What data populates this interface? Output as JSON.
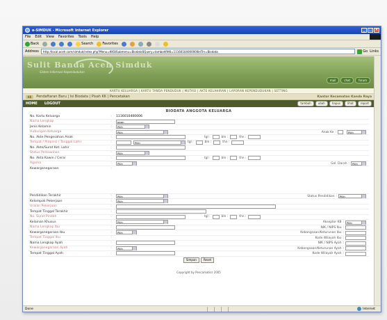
{
  "window": {
    "title": "e-SIMDUK - Microsoft Internet Explorer",
    "controls": [
      "_",
      "□",
      "×"
    ]
  },
  "menu": [
    "File",
    "Edit",
    "View",
    "Favorites",
    "Tools",
    "Help"
  ],
  "toolbar": {
    "back": "Back",
    "search": "Search",
    "favorites": "Favorites"
  },
  "address": {
    "label": "Address",
    "url": "http://local.aceh.com/simduk/index.php?Menu=KKStSubmenu=BiodataSQuery=tambahRKK=11160104000000ktTrn=Biodata",
    "go": "Go",
    "links": "Links"
  },
  "banner": {
    "title": "Sulit Banda Aceh Simduk",
    "subtitle": "Sistem Informasi Kependudukan",
    "buttons": [
      "mail",
      "chat",
      "forum"
    ]
  },
  "navlinks": "KARTU KELUARGA | KARTU TANDA PENDUDUK | MUTASI | AKTE KELAHIRAN | LAPORAN KEPENDUDUKAN | SETTING",
  "subnav": {
    "tag": "KK",
    "links": "Pendaftaran Baru | Isi Biodata | Pisah KK | Pencetakan",
    "office": "Kantor Kecamatan Kanda Raya"
  },
  "homebar": {
    "home": "HOME",
    "logout": "LOGOUT",
    "actions": [
      "tambah",
      "ubah",
      "hapus",
      "lihat",
      "report"
    ]
  },
  "form": {
    "title": "BIODATA ANGGOTA KELUARGA",
    "sep": ":",
    "kk_number": "1116010400006",
    "name": "ppan",
    "option": "Pilih",
    "tgl": "tgl :",
    "bln": "bln :",
    "thn": "thn :",
    "anak_ke": "Anak Ke",
    "gol_darah": "Gol. Darah",
    "status_pendidikan": "Status Pendidikan",
    "akseptor_kb": "Akseptor KB",
    "nik_nips_ibu": "NIK / NIPS Ibu",
    "kode_wilayah_ibu": "Kode Wilayah Ibu",
    "kebangsaan_ibu": "Kebangsaan/Keturunan Ibu",
    "nik_nips_ayah": "NIK / NIPS Ayah",
    "kebangsaan_ayah": "Kebangsaan/Keturunan Ayah",
    "kode_wilayah_ayah": "Kode Wilayah Ayah",
    "fields": {
      "no_kk": "No. Kartu Keluarga",
      "nama": "Nama Lengkap",
      "jk": "Jenis Kelamin",
      "hub": "Hubungan Keluarga",
      "akte_pengesahan": "No. Akte Pengesahan Anak",
      "ttl": "Tempat / Propinsi / Tanggal Lahir",
      "akte_lahir": "No. Akte/Surat Ket. Lahir",
      "status_kawin": "Status Perkawinan",
      "akte_kawin": "No. Akta Kawin / Cerai",
      "agama": "Agama",
      "kewarganegaraan": "Kewarganegaraan",
      "pendidikan": "Pendidikan Terakhir",
      "kelompok": "Kelompok Pekerjaan",
      "uraian": "Uraian Pekerjaan",
      "alamat": "Tempat Tinggal Terakhir",
      "surat_pindah": "No. Surat Pindah",
      "kelainan": "Kelainan Khusus",
      "nama_ibu": "Nama Lengkap Ibu",
      "kwn_ibu": "Kewarganegaraan Ibu",
      "tt_ibu": "Tempat Tinggal Ibu",
      "nama_ayah": "Nama Lengkap Ayah",
      "kwn_ayah": "Kewarganegaraan Ayah",
      "tt_ayah": "Tempat Tinggal Ayah"
    },
    "buttons": {
      "simpan": "Simpan",
      "reset": "Reset"
    }
  },
  "footer": "Copyright by Pencamatics 2005",
  "status": {
    "left": "Done",
    "zone": "Internet"
  }
}
